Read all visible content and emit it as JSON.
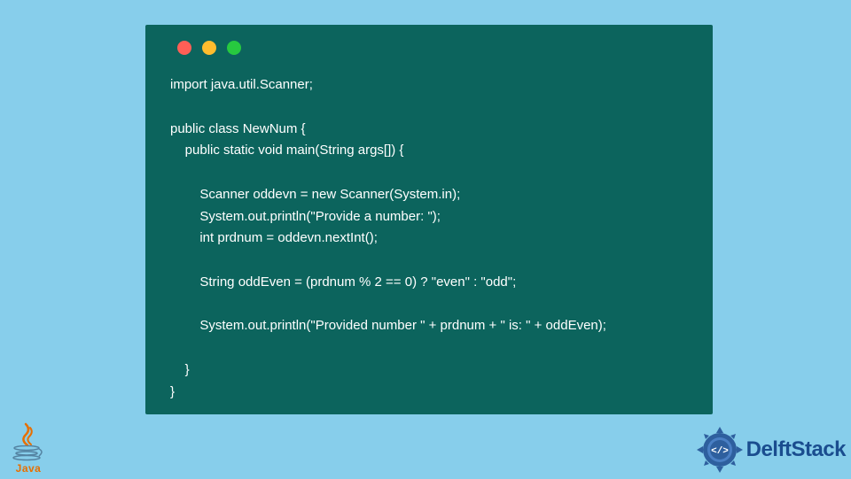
{
  "code": {
    "lines": [
      "import java.util.Scanner;",
      "",
      "public class NewNum {",
      "    public static void main(String args[]) {",
      "",
      "        Scanner oddevn = new Scanner(System.in);",
      "        System.out.println(\"Provide a number: \");",
      "        int prdnum = oddevn.nextInt();",
      "",
      "        String oddEven = (prdnum % 2 == 0) ? \"even\" : \"odd\";",
      "",
      "        System.out.println(\"Provided number \" + prdnum + \" is: \" + oddEven);",
      "",
      "    }",
      "}"
    ]
  },
  "logos": {
    "java": "Java",
    "delftstack": "DelftStack"
  },
  "colors": {
    "background": "#87ceeb",
    "window": "#0c645d",
    "dot_red": "#ff5f56",
    "dot_yellow": "#ffbd2e",
    "dot_green": "#27c93f",
    "java_orange": "#e76f00",
    "delft_blue": "#1a4d8f"
  }
}
